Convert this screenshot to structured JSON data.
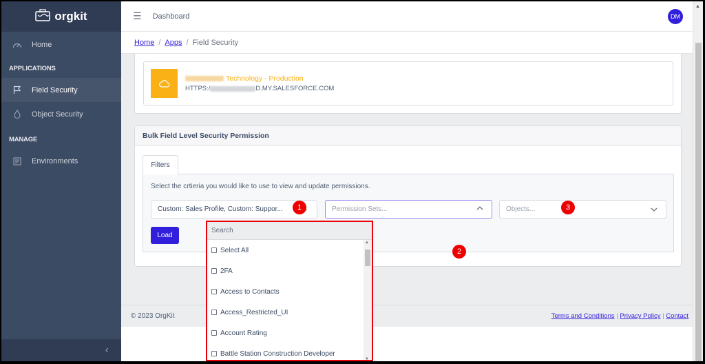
{
  "app": {
    "name": "orgkit"
  },
  "sidebar": {
    "home": "Home",
    "sections": [
      {
        "title": "APPLICATIONS",
        "items": [
          {
            "label": "Field Security",
            "icon": "flag-icon",
            "active": true
          },
          {
            "label": "Object Security",
            "icon": "drop-icon",
            "active": false
          }
        ]
      },
      {
        "title": "MANAGE",
        "items": [
          {
            "label": "Environments",
            "icon": "list-icon",
            "active": false
          }
        ]
      }
    ],
    "collapse_icon": "chevron-left-icon"
  },
  "header": {
    "title": "Dashboard",
    "avatar_initials": "DM"
  },
  "breadcrumb": {
    "items": [
      "Home",
      "Apps",
      "Field Security"
    ]
  },
  "environment": {
    "name_suffix": "Technology - Production",
    "url_prefix": "HTTPS:/",
    "url_suffix": "D.MY.SALESFORCE.COM"
  },
  "bulk": {
    "title": "Bulk Field Level Security Permission",
    "tab": "Filters",
    "hint": "Select the crtieria you would like to use to view and update permissions.",
    "profiles_value": "Custom: Sales Profile, Custom: Suppor...",
    "permission_sets_placeholder": "Permission Sets...",
    "objects_placeholder": "Objects...",
    "load_label": "Load"
  },
  "dropdown": {
    "search_placeholder": "Search",
    "items": [
      "Select All",
      "2FA",
      "Access to Contacts",
      "Access_Restricted_UI",
      "Account Rating",
      "Battle Station Construction Developer"
    ]
  },
  "annotations": [
    "1",
    "2",
    "3"
  ],
  "footer": {
    "copyright": "© 2023 OrgKit",
    "links": [
      "Terms and Conditions",
      "Privacy Policy",
      "Contact"
    ]
  }
}
